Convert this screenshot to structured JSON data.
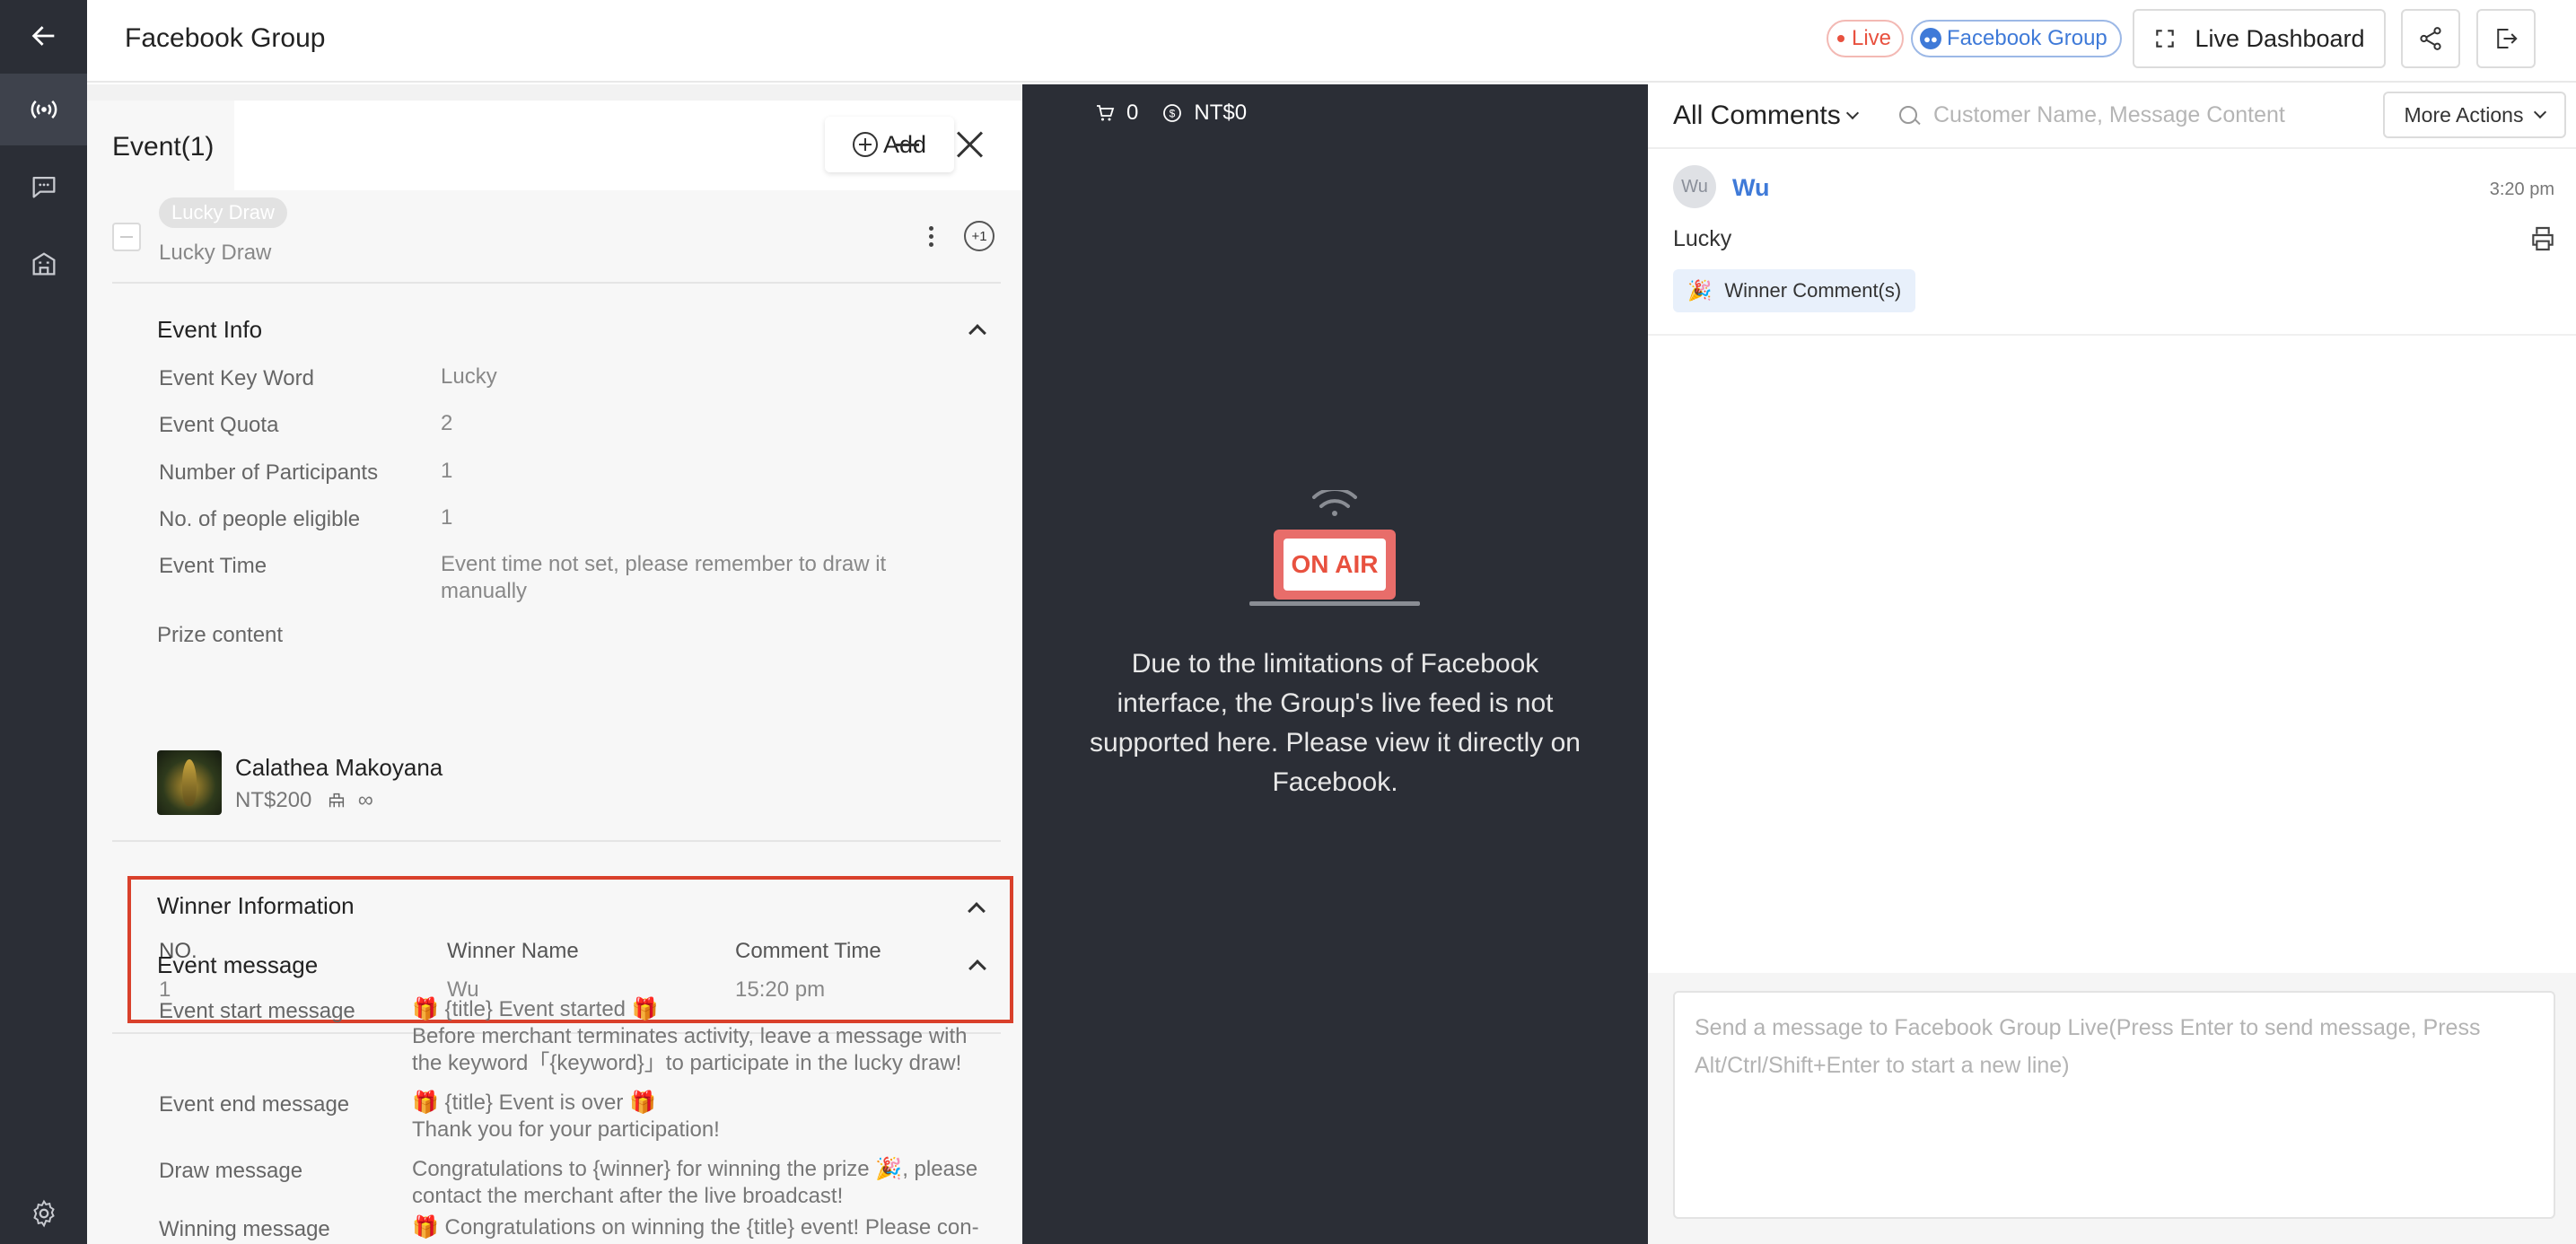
{
  "header": {
    "title": "Facebook Group",
    "live_label": "Live",
    "group_label": "Facebook Group",
    "dashboard_label": "Live Dashboard"
  },
  "event_panel": {
    "tab_label": "Event(1)",
    "add_label": "Add",
    "draw": {
      "chip": "Lucky Draw",
      "name": "Lucky Draw",
      "plus_label": "+1"
    },
    "event_info": {
      "title": "Event Info",
      "rows": [
        {
          "label": "Event Key Word",
          "value": "Lucky"
        },
        {
          "label": "Event Quota",
          "value": "2"
        },
        {
          "label": "Number of Participants",
          "value": "1"
        },
        {
          "label": "No. of people eligible",
          "value": "1"
        },
        {
          "label": "Event Time",
          "value": "Event time not set, please remember to draw it manually"
        }
      ]
    },
    "prize": {
      "label": "Prize content",
      "name": "Calathea Makoyana",
      "price": "NT$200",
      "stock": "∞"
    },
    "winner_info": {
      "title": "Winner Information",
      "headers": [
        "NO.",
        "Winner Name",
        "Comment Time"
      ],
      "rows": [
        [
          "1",
          "Wu",
          "15:20 pm"
        ]
      ]
    },
    "event_message": {
      "title": "Event message",
      "rows": [
        {
          "label": "Event start message",
          "value": "🎁 {title} Event started 🎁\nBefore merchant terminates activity, leave a message with the keyword「{keyword}」to participate in the lucky draw!"
        },
        {
          "label": "Event end message",
          "value": "🎁 {title} Event is over 🎁\nThank you for your participation!"
        },
        {
          "label": "Draw message",
          "value": "Congratulations to {winner} for winning the prize 🎉, please contact the merchant after the live broadcast!"
        },
        {
          "label": "Winning message",
          "value": "🎁 Congratulations on winning the {title} event! Please con-"
        }
      ]
    }
  },
  "video": {
    "cart_count": "0",
    "amount": "NT$0",
    "on_air": "ON AIR",
    "notice": "Due to the limitations of Facebook interface, the Group's live feed is not supported here. Please view it directly on Facebook."
  },
  "comments": {
    "title": "All Comments",
    "search_placeholder": "Customer Name, Message Content",
    "more_actions": "More Actions",
    "items": [
      {
        "avatar": "Wu",
        "name": "Wu",
        "time": "3:20 pm",
        "text": "Lucky",
        "badge": "Winner Comment(s)"
      }
    ],
    "message_placeholder": "Send a message to Facebook Group Live(Press Enter to send message, Press Alt/Ctrl/Shift+Enter to start a new line)"
  },
  "colors": {
    "rail": "#2b2e36",
    "accent_red": "#e8513f",
    "link_blue": "#3f7ad8",
    "highlight_box": "#d9402b"
  }
}
